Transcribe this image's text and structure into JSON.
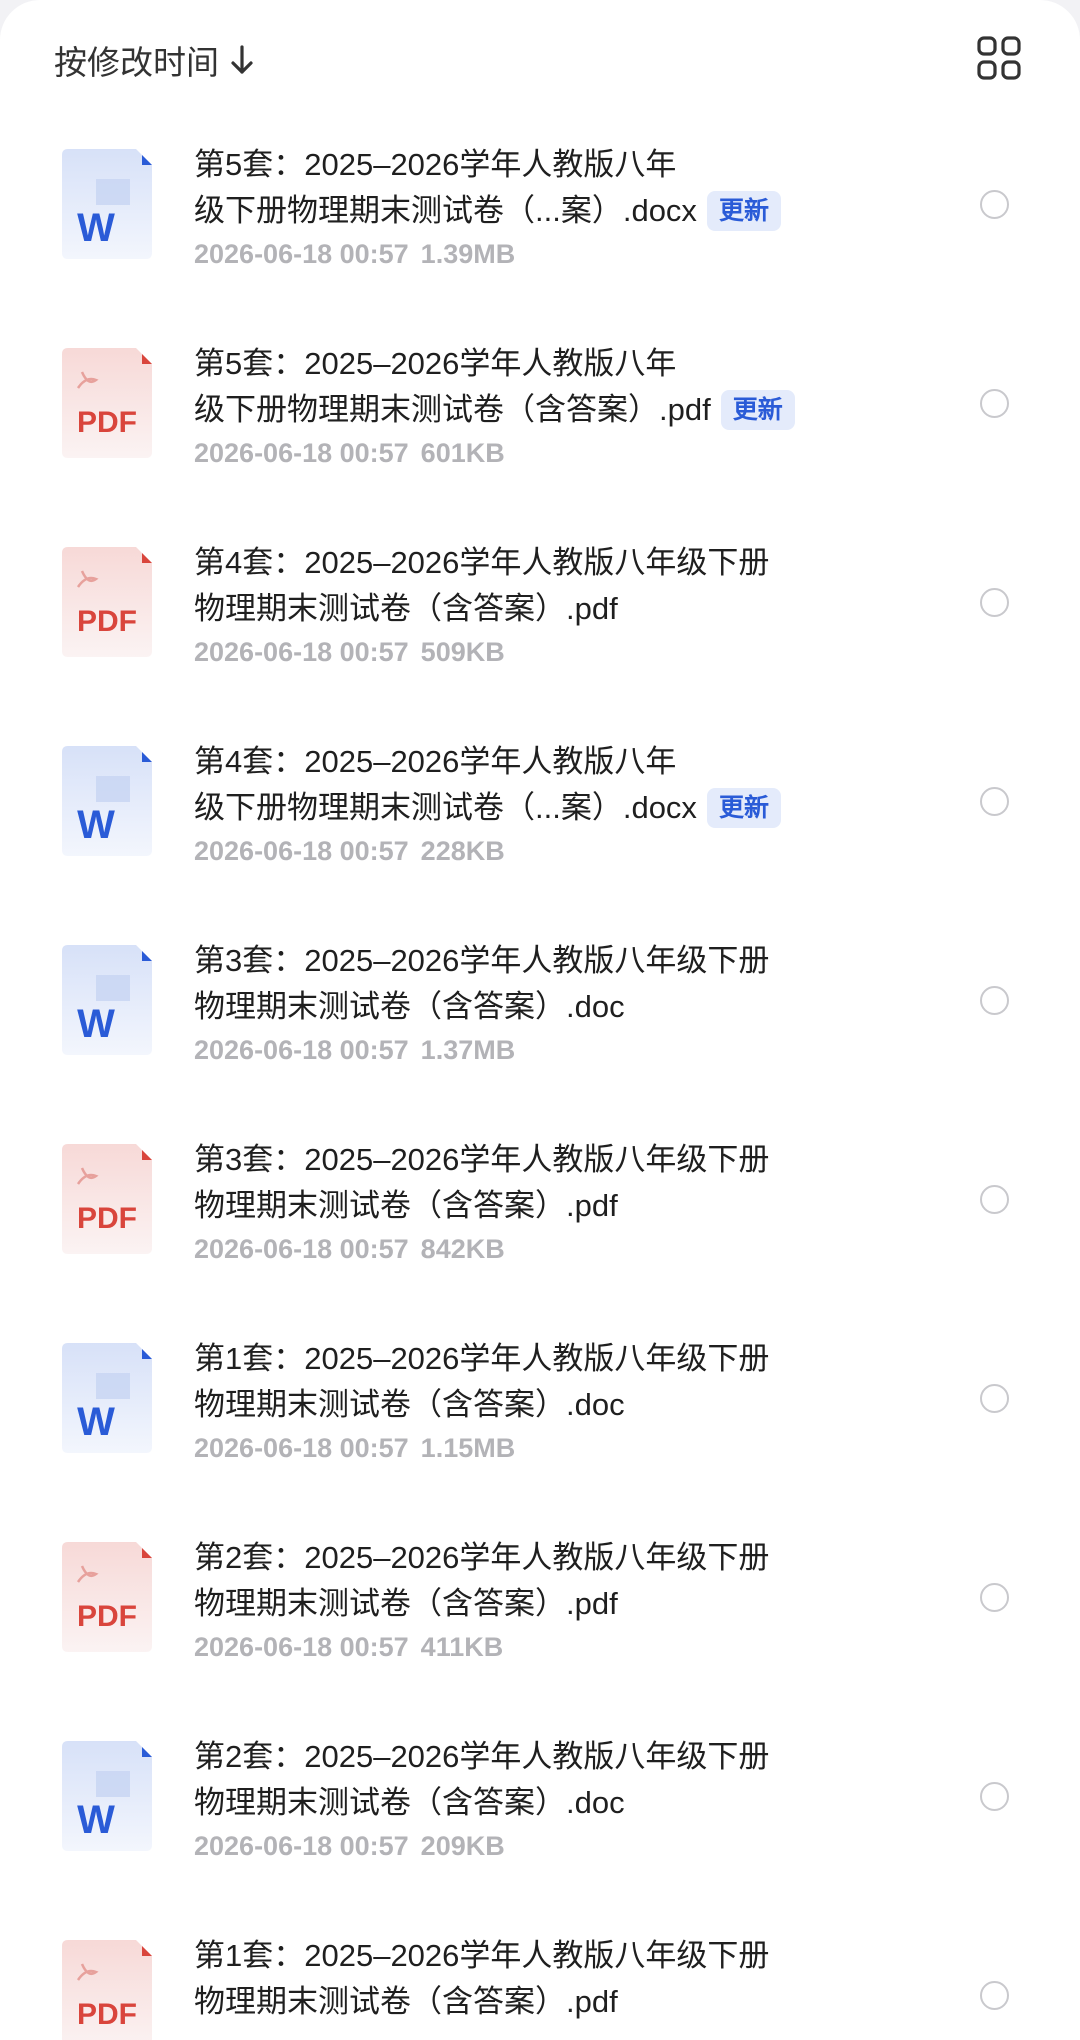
{
  "toolbar": {
    "sort_label": "按修改时间",
    "sort_icon": "arrow-down-icon",
    "view_icon": "grid-view-icon"
  },
  "colors": {
    "word_blue": "#2a5bd7",
    "pdf_red": "#d9453c",
    "badge_bg": "#e4ebfb",
    "meta_gray": "#b3b3b7"
  },
  "files": [
    {
      "type": "word",
      "icon_label": "W",
      "title_line1": "第5套：2025–2026学年人教版八年",
      "title_line2": "级下册物理期末测试卷（...案）.docx",
      "badge": "更新",
      "date": "2026-06-18 00:57",
      "size": "1.39MB"
    },
    {
      "type": "pdf",
      "icon_label": "PDF",
      "title_line1": "第5套：2025–2026学年人教版八年",
      "title_line2": "级下册物理期末测试卷（含答案）.pdf",
      "badge": "更新",
      "date": "2026-06-18 00:57",
      "size": "601KB"
    },
    {
      "type": "pdf",
      "icon_label": "PDF",
      "title_line1": "第4套：2025–2026学年人教版八年级下册",
      "title_line2": "物理期末测试卷（含答案）.pdf",
      "badge": "",
      "date": "2026-06-18 00:57",
      "size": "509KB"
    },
    {
      "type": "word",
      "icon_label": "W",
      "title_line1": "第4套：2025–2026学年人教版八年",
      "title_line2": "级下册物理期末测试卷（...案）.docx",
      "badge": "更新",
      "date": "2026-06-18 00:57",
      "size": "228KB"
    },
    {
      "type": "word",
      "icon_label": "W",
      "title_line1": "第3套：2025–2026学年人教版八年级下册",
      "title_line2": "物理期末测试卷（含答案）.doc",
      "badge": "",
      "date": "2026-06-18 00:57",
      "size": "1.37MB"
    },
    {
      "type": "pdf",
      "icon_label": "PDF",
      "title_line1": "第3套：2025–2026学年人教版八年级下册",
      "title_line2": "物理期末测试卷（含答案）.pdf",
      "badge": "",
      "date": "2026-06-18 00:57",
      "size": "842KB"
    },
    {
      "type": "word",
      "icon_label": "W",
      "title_line1": "第1套：2025–2026学年人教版八年级下册",
      "title_line2": "物理期末测试卷（含答案）.doc",
      "badge": "",
      "date": "2026-06-18 00:57",
      "size": "1.15MB"
    },
    {
      "type": "pdf",
      "icon_label": "PDF",
      "title_line1": "第2套：2025–2026学年人教版八年级下册",
      "title_line2": "物理期末测试卷（含答案）.pdf",
      "badge": "",
      "date": "2026-06-18 00:57",
      "size": "411KB"
    },
    {
      "type": "word",
      "icon_label": "W",
      "title_line1": "第2套：2025–2026学年人教版八年级下册",
      "title_line2": "物理期末测试卷（含答案）.doc",
      "badge": "",
      "date": "2026-06-18 00:57",
      "size": "209KB"
    },
    {
      "type": "pdf",
      "icon_label": "PDF",
      "title_line1": "第1套：2025–2026学年人教版八年级下册",
      "title_line2": "物理期末测试卷（含答案）.pdf",
      "badge": "",
      "date": "",
      "size": ""
    }
  ]
}
